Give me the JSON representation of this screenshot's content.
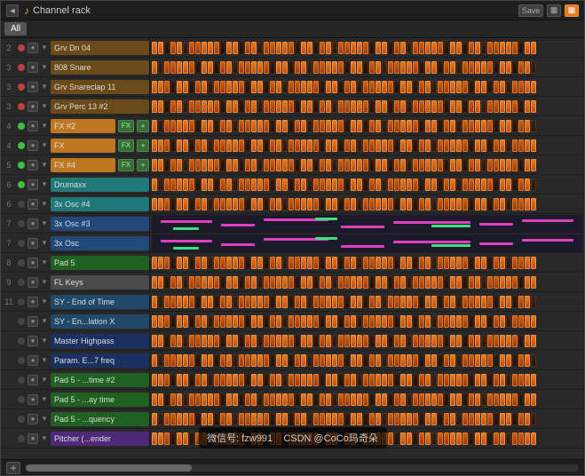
{
  "titleBar": {
    "icon": "♪",
    "title": "Channel rack",
    "backBtn": "◄",
    "filterAll": "All",
    "buttons": [
      "save",
      "views",
      "grid"
    ]
  },
  "channels": [
    {
      "num": "2",
      "name": "Grv Dn 04",
      "colorClass": "brown",
      "hasFx": false,
      "pattern": "beats"
    },
    {
      "num": "3",
      "name": "808 Snare",
      "colorClass": "brown",
      "hasFx": false,
      "pattern": "beats"
    },
    {
      "num": "3",
      "name": "Grv Snareclap 11",
      "colorClass": "brown",
      "hasFx": false,
      "pattern": "beats"
    },
    {
      "num": "3",
      "name": "Grv Perc 13 #2",
      "colorClass": "brown",
      "hasFx": false,
      "pattern": "beats"
    },
    {
      "num": "4",
      "name": "FX #2",
      "colorClass": "orange",
      "hasFx": true,
      "pattern": "beats"
    },
    {
      "num": "4",
      "name": "FX",
      "colorClass": "orange",
      "hasFx": true,
      "pattern": "beats"
    },
    {
      "num": "5",
      "name": "FX #4",
      "colorClass": "orange",
      "hasFx": true,
      "pattern": "beats"
    },
    {
      "num": "6",
      "name": "Drumaxx",
      "colorClass": "teal",
      "hasFx": false,
      "pattern": "beats"
    },
    {
      "num": "6",
      "name": "3x Osc #4",
      "colorClass": "teal",
      "hasFx": false,
      "pattern": "beats"
    },
    {
      "num": "7",
      "name": "3x Osc #3",
      "colorClass": "blue",
      "hasFx": false,
      "pattern": "piano"
    },
    {
      "num": "7",
      "name": "3x Osc",
      "colorClass": "blue",
      "hasFx": false,
      "pattern": "piano"
    },
    {
      "num": "8",
      "name": "Pad 5",
      "colorClass": "darkgreen",
      "hasFx": false,
      "pattern": "beats"
    },
    {
      "num": "9",
      "name": "FL Keys",
      "colorClass": "gray",
      "hasFx": false,
      "pattern": "beats"
    },
    {
      "num": "11",
      "name": "SY - End of Time",
      "colorClass": "lightblue",
      "hasFx": false,
      "pattern": "beats"
    },
    {
      "num": "",
      "name": "SY - En...lation X",
      "colorClass": "lightblue",
      "hasFx": false,
      "pattern": "beats"
    },
    {
      "num": "",
      "name": "Master Highpass",
      "colorClass": "darkblue",
      "hasFx": false,
      "pattern": "beats"
    },
    {
      "num": "",
      "name": "Param. E...7 freq",
      "colorClass": "darkblue",
      "hasFx": false,
      "pattern": "beats"
    },
    {
      "num": "",
      "name": "Pad 5 - ...time #2",
      "colorClass": "darkgreen",
      "hasFx": false,
      "pattern": "beats"
    },
    {
      "num": "",
      "name": "Pad 5 - ...ay time",
      "colorClass": "darkgreen",
      "hasFx": false,
      "pattern": "beats"
    },
    {
      "num": "",
      "name": "Pad 5 - ...quency",
      "colorClass": "darkgreen",
      "hasFx": false,
      "pattern": "beats"
    },
    {
      "num": "",
      "name": "Pitcher (...ender",
      "colorClass": "purple",
      "hasFx": false,
      "pattern": "beats"
    }
  ],
  "watermark": {
    "line1": "微信号: fzw991",
    "line2": "CSDN @CoCo玛奇朵"
  },
  "bottomBar": {
    "addLabel": "+"
  }
}
